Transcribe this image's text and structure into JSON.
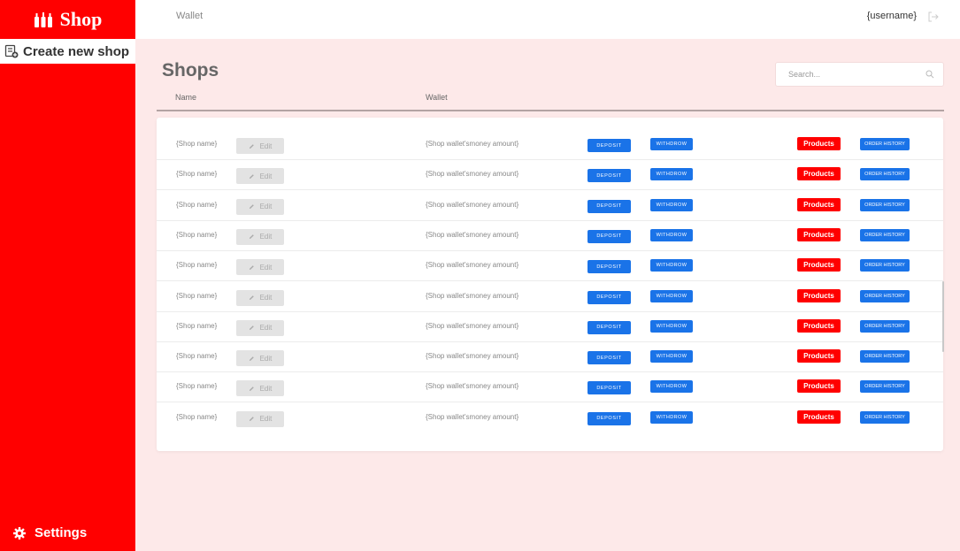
{
  "brand": {
    "name": "Shop"
  },
  "sidebar": {
    "create_shop_label": "Create new shop",
    "settings_label": "Settings"
  },
  "header": {
    "nav_wallet": "Wallet",
    "username": "{username}"
  },
  "page": {
    "title": "Shops"
  },
  "search": {
    "placeholder": "Search..."
  },
  "table": {
    "columns": [
      "Name",
      "Wallet"
    ],
    "edit_label": "Edit",
    "deposit_label": "DEPOSIT",
    "withdraw_label": "WITHDROW",
    "products_label": "Products",
    "order_history_label": "ORDER HISTORY",
    "rows": [
      {
        "name": "{Shop name}",
        "wallet": "{Shop wallet'smoney amount}"
      },
      {
        "name": "{Shop name}",
        "wallet": "{Shop wallet'smoney amount}"
      },
      {
        "name": "{Shop name}",
        "wallet": "{Shop wallet'smoney amount}"
      },
      {
        "name": "{Shop name}",
        "wallet": "{Shop wallet'smoney amount}"
      },
      {
        "name": "{Shop name}",
        "wallet": "{Shop wallet'smoney amount}"
      },
      {
        "name": "{Shop name}",
        "wallet": "{Shop wallet'smoney amount}"
      },
      {
        "name": "{Shop name}",
        "wallet": "{Shop wallet'smoney amount}"
      },
      {
        "name": "{Shop name}",
        "wallet": "{Shop wallet'smoney amount}"
      },
      {
        "name": "{Shop name}",
        "wallet": "{Shop wallet'smoney amount}"
      },
      {
        "name": "{Shop name}",
        "wallet": "{Shop wallet'smoney amount}"
      }
    ]
  },
  "colors": {
    "brand_red": "#ff0000",
    "accent_blue": "#1a73e8",
    "background_pink": "#fde9e9"
  },
  "icons": [
    "bottles-icon",
    "create-shop-icon",
    "gear-icon",
    "logout-icon",
    "search-icon",
    "pencil-icon"
  ]
}
